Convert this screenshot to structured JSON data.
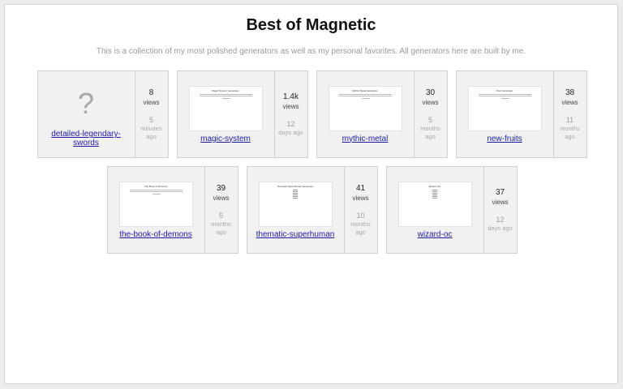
{
  "page": {
    "title": "Best of Magnetic",
    "subtitle": "This is a collection of my most polished generators as well as my personal favorites. All generators here are built by me."
  },
  "cards": [
    {
      "name": "detailed-legendary-swords",
      "thumbnail": "question-mark",
      "placeholder_glyph": "?",
      "views": "8",
      "views_label": "views",
      "ago_num": "5",
      "ago_unit": "minutes ago"
    },
    {
      "name": "magic-system",
      "thumbnail": "preview",
      "thumb_title": "Magic System Generator",
      "views": "1.4k",
      "views_label": "views",
      "ago_num": "12",
      "ago_unit": "days ago"
    },
    {
      "name": "mythic-metal",
      "thumbnail": "preview",
      "thumb_title": "Mythic Metal Generator",
      "views": "30",
      "views_label": "views",
      "ago_num": "5",
      "ago_unit": "months ago"
    },
    {
      "name": "new-fruits",
      "thumbnail": "preview",
      "thumb_title": "Fruit Generator",
      "views": "38",
      "views_label": "views",
      "ago_num": "11",
      "ago_unit": "months ago"
    },
    {
      "name": "the-book-of-demons",
      "thumbnail": "preview",
      "thumb_title": "The Book of Demons",
      "views": "39",
      "views_label": "views",
      "ago_num": "5",
      "ago_unit": "months ago"
    },
    {
      "name": "thematic-superhuman",
      "thumbnail": "preview-list",
      "thumb_title": "Thematic Superhuman Generator",
      "views": "41",
      "views_label": "views",
      "ago_num": "10",
      "ago_unit": "months ago"
    },
    {
      "name": "wizard-oc",
      "thumbnail": "preview-list",
      "thumb_title": "Wizard OC",
      "views": "37",
      "views_label": "views",
      "ago_num": "12",
      "ago_unit": "days ago"
    }
  ],
  "colors": {
    "link": "#1a1aa6",
    "card_bg": "#f1f1f1",
    "card_border": "#cfcfcf",
    "muted_text": "#9c9c9c"
  }
}
